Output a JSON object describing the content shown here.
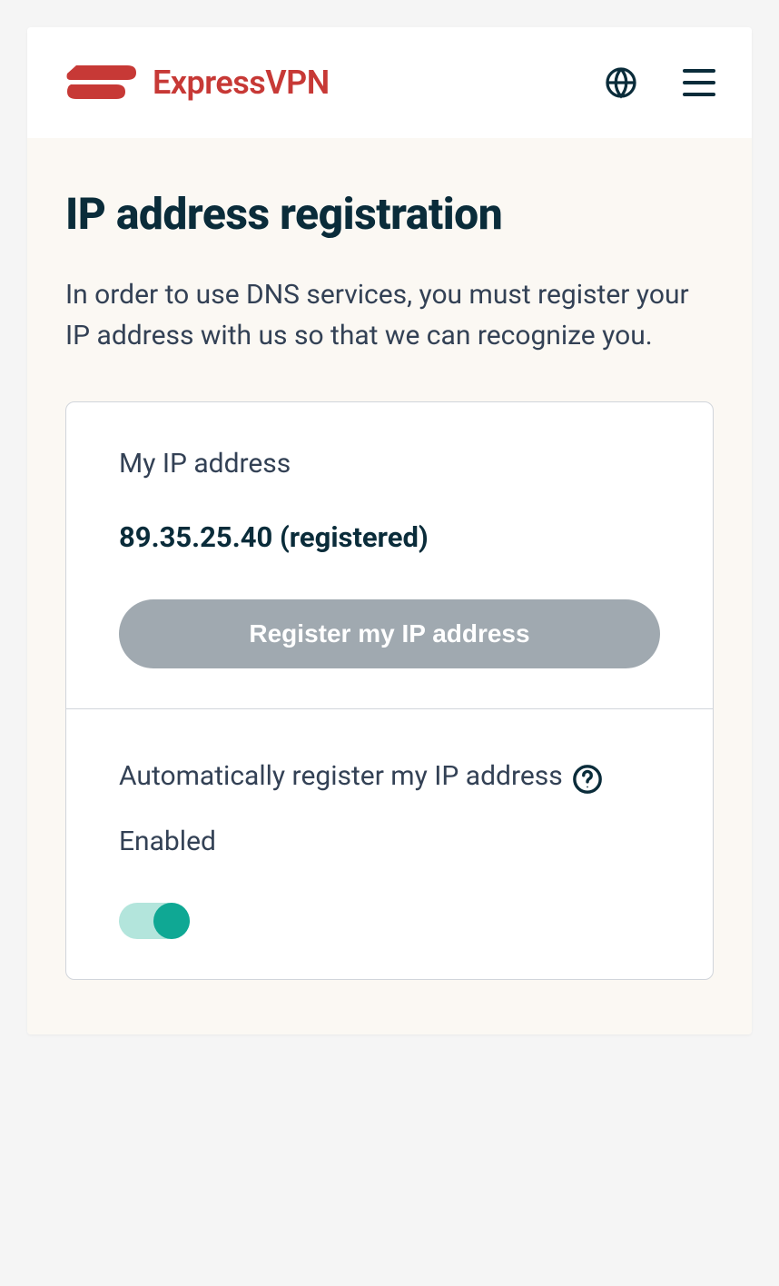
{
  "header": {
    "brand": "ExpressVPN"
  },
  "main": {
    "title": "IP address registration",
    "description": "In order to use DNS services, you must register your IP address with us so that we can recognize you."
  },
  "card": {
    "ip_label": "My IP address",
    "ip_value": "89.35.25.40 (registered)",
    "register_button": "Register my IP address",
    "auto_label": "Automatically register my IP address",
    "status": "Enabled"
  }
}
